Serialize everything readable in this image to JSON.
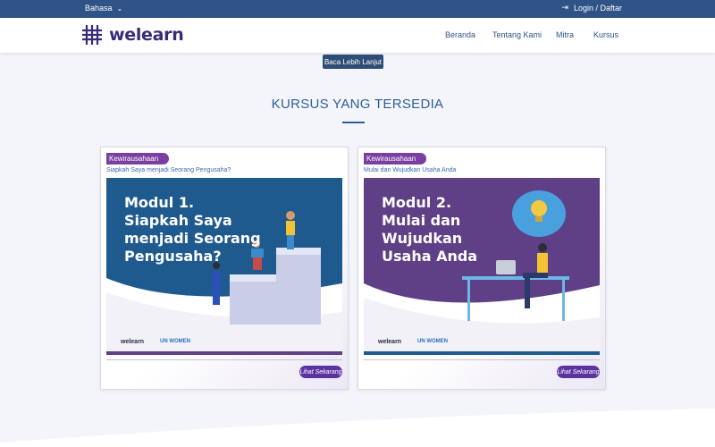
{
  "topbar": {
    "language_label": "Bahasa",
    "login_label": "Login / Daftar"
  },
  "brand": {
    "name": "welearn"
  },
  "nav": {
    "items": [
      "Beranda",
      "Tentang Kami",
      "Mitra",
      "Kursus"
    ]
  },
  "hero": {
    "read_more_label": "Baca Lebih Lanjut"
  },
  "section": {
    "title": "KURSUS YANG TERSEDIA"
  },
  "courses": [
    {
      "category": "Kewirausahaan",
      "subtitle": "Siapkah Saya menjadi Seorang Pengusaha?",
      "thumb_title": "Modul 1.\nSiapkah Saya\nmenjadi Seorang\nPengusaha?",
      "thumb_logo_left": "welearn",
      "thumb_logo_right": "UN WOMEN",
      "cta_label": "Lihat Sekarang",
      "theme_color": "#1f5a8f"
    },
    {
      "category": "Kewirausahaan",
      "subtitle": "Mulai dan Wujudkan Usaha Anda",
      "thumb_title": "Modul 2.\nMulai dan\nWujudkan\nUsaha Anda",
      "thumb_logo_left": "welearn",
      "thumb_logo_right": "UN WOMEN",
      "cta_label": "Lihat Sekarang",
      "theme_color": "#5f3f86"
    }
  ],
  "colors": {
    "topbar": "#2f5386",
    "accent": "#2f5e96",
    "badge": "#7a3fa0",
    "cta": "#5b33a0",
    "background": "#f4f5fb"
  }
}
